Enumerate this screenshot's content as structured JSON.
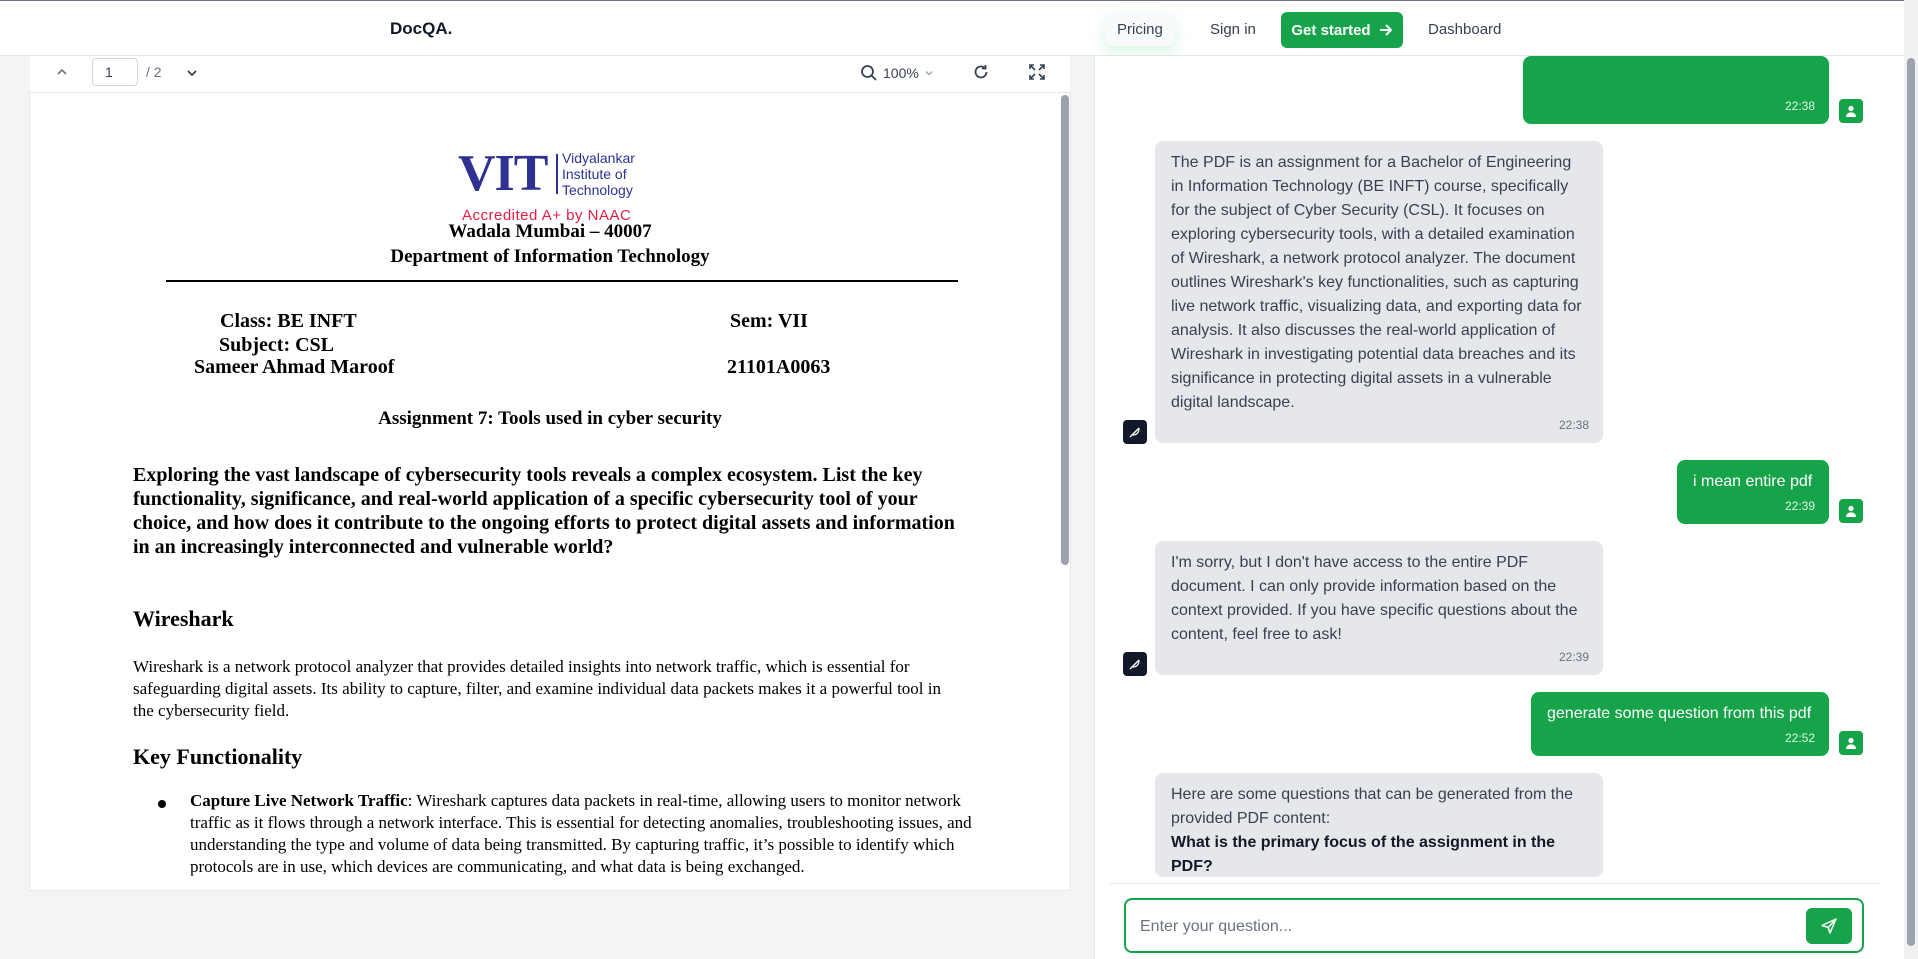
{
  "navbar": {
    "brand": "DocQA.",
    "pricing": "Pricing",
    "sign_in": "Sign in",
    "get_started": "Get started",
    "dashboard": "Dashboard"
  },
  "pdf_toolbar": {
    "page_current": "1",
    "page_total": "/ 2",
    "zoom": "100%"
  },
  "pdf": {
    "logo_vit": "VIT",
    "logo_name_line1": "Vidyalankar",
    "logo_name_line2": "Institute of",
    "logo_name_line3": "Technology",
    "logo_accreditation": "Accredited A+ by NAAC",
    "address": "Wadala Mumbai – 40007",
    "department": "Department of Information Technology",
    "class": "Class: BE INFT",
    "sem": "Sem: VII",
    "subject": "Subject: CSL",
    "student_name": "Sameer Ahmad Maroof",
    "roll_no": "21101A0063",
    "assignment_title": "Assignment 7: Tools used in cyber security",
    "question": "Exploring the vast landscape of cybersecurity tools reveals a complex ecosystem. List the key functionality, significance, and real-world application of a specific cybersecurity tool of your choice, and how does it contribute to the ongoing efforts to protect digital assets and information in an increasingly interconnected and vulnerable world?",
    "heading_wireshark": "Wireshark",
    "para_wireshark": "Wireshark is a network protocol analyzer that provides detailed insights into network traffic, which is essential for safeguarding digital assets. Its ability to capture, filter, and examine individual data packets makes it a powerful tool in the cybersecurity field.",
    "heading_key": "Key Functionality",
    "bullet_title": "Capture Live Network Traffic",
    "bullet_text": ": Wireshark captures data packets in real-time, allowing users to monitor network traffic as it flows through a network interface. This is essential for detecting anomalies, troubleshooting issues, and understanding the type and volume of data being transmitted. By capturing traffic, it’s possible to identify which protocols are in use, which devices are communicating, and what data is being exchanged."
  },
  "chat": {
    "messages": [
      {
        "role": "user",
        "text": "",
        "time": "22:38"
      },
      {
        "role": "bot",
        "text": "The PDF is an assignment for a Bachelor of Engineering in Information Technology (BE INFT) course, specifically for the subject of Cyber Security (CSL). It focuses on exploring cybersecurity tools, with a detailed examination of Wireshark, a network protocol analyzer. The document outlines Wireshark's key functionalities, such as capturing live network traffic, visualizing data, and exporting data for analysis. It also discusses the real-world application of Wireshark in investigating potential data breaches and its significance in protecting digital assets in a vulnerable digital landscape.",
        "time": "22:38"
      },
      {
        "role": "user",
        "text": "i mean entire pdf",
        "time": "22:39"
      },
      {
        "role": "bot",
        "text": "I'm sorry, but I don't have access to the entire PDF document. I can only provide information based on the context provided. If you have specific questions about the content, feel free to ask!",
        "time": "22:39"
      },
      {
        "role": "user",
        "text": "generate some question from this pdf",
        "time": "22:52"
      },
      {
        "role": "bot",
        "text": "Here are some questions that can be generated from the provided PDF content:",
        "bold": "What is the primary focus of the assignment in the PDF?",
        "time": ""
      }
    ],
    "input_placeholder": "Enter your question..."
  },
  "colors": {
    "accent": "#16a34a",
    "vit_blue": "#2e3192",
    "naac_red": "#e11d48"
  }
}
